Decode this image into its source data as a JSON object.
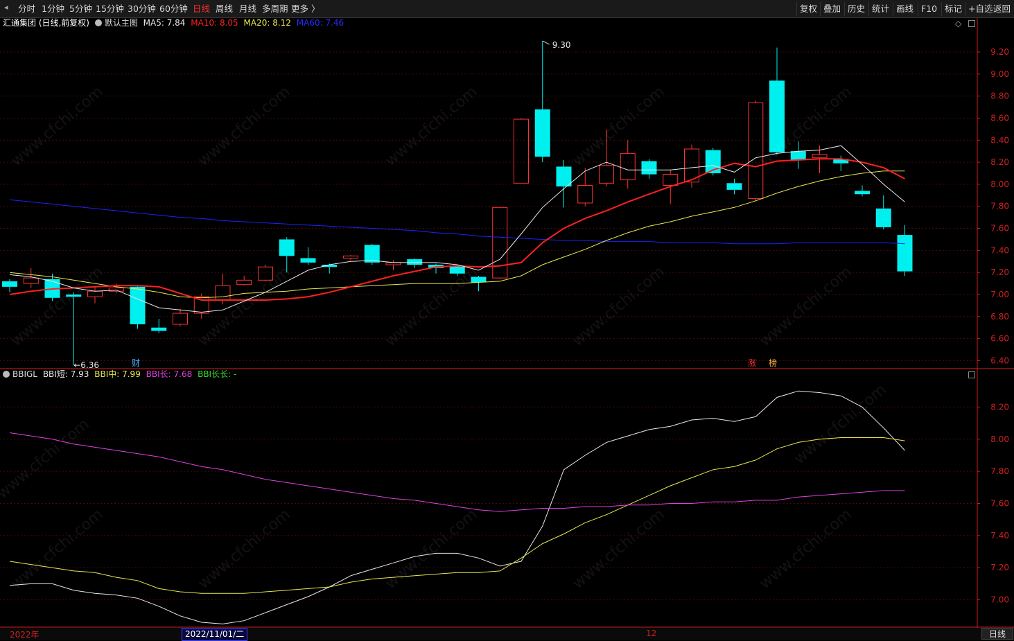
{
  "toolbar": {
    "periods": [
      "分时",
      "1分钟",
      "5分钟",
      "15分钟",
      "30分钟",
      "60分钟",
      "日线",
      "周线",
      "月线",
      "多周期",
      "更多 〉"
    ],
    "active_period": "日线",
    "right_buttons": [
      "复权",
      "叠加",
      "历史",
      "统计",
      "画线",
      "F10",
      "标记",
      "+自选",
      "返回"
    ]
  },
  "main_header": {
    "stock": "汇通集团 (日线,前复权)",
    "template": "默认主图",
    "ma5": "MA5: 7.84",
    "ma10": "MA10: 8.05",
    "ma20": "MA20: 8.12",
    "ma60": "MA60: 7.46"
  },
  "indicator_header": {
    "name": "BBIGL",
    "bbi_short": "BBI短: 7.93",
    "bbi_mid": "BBI中: 7.99",
    "bbi_long": "BBI长: 7.68",
    "bbi_longlong": "BBI长长: -"
  },
  "markers": {
    "high": "9.30",
    "low": "←6.36",
    "cai": "财",
    "zhang": "涨",
    "bang": "榜"
  },
  "x_axis": {
    "labels": [
      "2022年",
      "12"
    ],
    "cursor_date": "2022/11/01/二",
    "period_button": "日线"
  },
  "watermark": "www.cfchi.com",
  "colors": {
    "up": "#ff3232",
    "down": "#00f0f0",
    "ma5": "#e8e8e8",
    "ma10": "#ff2020",
    "ma20": "#e8e850",
    "ma60": "#2020ff",
    "bbi_short": "#e8e8e8",
    "bbi_mid": "#e8e850",
    "bbi_long": "#e040e0",
    "bbi_longlong": "#30e030",
    "axis": "#d02020"
  },
  "chart_data": [
    {
      "type": "candlestick",
      "y_ticks": [
        "9.20",
        "9.00",
        "8.80",
        "8.60",
        "8.40",
        "8.20",
        "8.00",
        "7.80",
        "7.60",
        "7.40",
        "7.20",
        "7.00",
        "6.80",
        "6.60",
        "6.40"
      ],
      "ylim": [
        6.34,
        9.42
      ],
      "candles": [
        {
          "o": 7.12,
          "c": 7.07,
          "h": 7.14,
          "l": 7.02
        },
        {
          "o": 7.1,
          "c": 7.15,
          "h": 7.24,
          "l": 7.06
        },
        {
          "o": 7.14,
          "c": 6.97,
          "h": 7.19,
          "l": 6.94
        },
        {
          "o": 7.0,
          "c": 6.98,
          "h": 7.02,
          "l": 6.36
        },
        {
          "o": 6.98,
          "c": 7.03,
          "h": 7.07,
          "l": 6.92
        },
        {
          "o": 7.03,
          "c": 7.06,
          "h": 7.1,
          "l": 7.01
        },
        {
          "o": 7.07,
          "c": 6.73,
          "h": 7.08,
          "l": 6.69
        },
        {
          "o": 6.7,
          "c": 6.67,
          "h": 6.78,
          "l": 6.65
        },
        {
          "o": 6.73,
          "c": 6.83,
          "h": 6.87,
          "l": 6.71
        },
        {
          "o": 6.83,
          "c": 6.98,
          "h": 7.01,
          "l": 6.78
        },
        {
          "o": 6.95,
          "c": 7.08,
          "h": 7.19,
          "l": 6.91
        },
        {
          "o": 7.09,
          "c": 7.13,
          "h": 7.17,
          "l": 7.08
        },
        {
          "o": 7.13,
          "c": 7.25,
          "h": 7.27,
          "l": 7.12
        },
        {
          "o": 7.5,
          "c": 7.35,
          "h": 7.52,
          "l": 7.2
        },
        {
          "o": 7.33,
          "c": 7.29,
          "h": 7.43,
          "l": 7.27
        },
        {
          "o": 7.27,
          "c": 7.25,
          "h": 7.28,
          "l": 7.19
        },
        {
          "o": 7.33,
          "c": 7.35,
          "h": 7.36,
          "l": 7.31
        },
        {
          "o": 7.45,
          "c": 7.29,
          "h": 7.46,
          "l": 7.27
        },
        {
          "o": 7.27,
          "c": 7.29,
          "h": 7.31,
          "l": 7.22
        },
        {
          "o": 7.32,
          "c": 7.27,
          "h": 7.33,
          "l": 7.24
        },
        {
          "o": 7.27,
          "c": 7.24,
          "h": 7.28,
          "l": 7.19
        },
        {
          "o": 7.26,
          "c": 7.19,
          "h": 7.27,
          "l": 7.17
        },
        {
          "o": 7.16,
          "c": 7.11,
          "h": 7.17,
          "l": 7.03
        },
        {
          "o": 7.15,
          "c": 7.79,
          "h": 7.79,
          "l": 7.14
        },
        {
          "o": 8.01,
          "c": 8.59,
          "h": 8.6,
          "l": 8.01
        },
        {
          "o": 8.68,
          "c": 8.25,
          "h": 9.3,
          "l": 8.2
        },
        {
          "o": 8.16,
          "c": 7.98,
          "h": 8.22,
          "l": 7.79
        },
        {
          "o": 7.83,
          "c": 7.99,
          "h": 8.15,
          "l": 7.8
        },
        {
          "o": 8.01,
          "c": 8.17,
          "h": 8.5,
          "l": 7.98
        },
        {
          "o": 8.04,
          "c": 8.28,
          "h": 8.4,
          "l": 7.96
        },
        {
          "o": 8.21,
          "c": 8.09,
          "h": 8.23,
          "l": 8.05
        },
        {
          "o": 7.99,
          "c": 8.09,
          "h": 8.13,
          "l": 7.82
        },
        {
          "o": 8.02,
          "c": 8.32,
          "h": 8.36,
          "l": 7.97
        },
        {
          "o": 8.31,
          "c": 8.1,
          "h": 8.33,
          "l": 8.08
        },
        {
          "o": 8.01,
          "c": 7.95,
          "h": 8.05,
          "l": 7.91
        },
        {
          "o": 7.87,
          "c": 8.74,
          "h": 8.76,
          "l": 7.85
        },
        {
          "o": 8.94,
          "c": 8.29,
          "h": 9.24,
          "l": 8.27
        },
        {
          "o": 8.3,
          "c": 8.22,
          "h": 8.39,
          "l": 8.14
        },
        {
          "o": 8.24,
          "c": 8.27,
          "h": 8.35,
          "l": 8.1
        },
        {
          "o": 8.23,
          "c": 8.19,
          "h": 8.26,
          "l": 8.12
        },
        {
          "o": 7.94,
          "c": 7.91,
          "h": 7.99,
          "l": 7.89
        },
        {
          "o": 7.78,
          "c": 7.61,
          "h": 7.9,
          "l": 7.59
        },
        {
          "o": 7.54,
          "c": 7.21,
          "h": 7.63,
          "l": 7.17
        }
      ],
      "ma5": [
        7.18,
        7.16,
        7.12,
        7.06,
        7.03,
        7.04,
        6.96,
        6.88,
        6.86,
        6.84,
        6.86,
        6.94,
        7.02,
        7.12,
        7.22,
        7.27,
        7.3,
        7.31,
        7.29,
        7.29,
        7.29,
        7.27,
        7.22,
        7.32,
        7.55,
        7.79,
        7.96,
        8.12,
        8.2,
        8.13,
        8.13,
        8.13,
        8.15,
        8.17,
        8.11,
        8.24,
        8.28,
        8.3,
        8.31,
        8.35,
        8.18,
        8.0,
        7.84
      ],
      "ma10": [
        7.0,
        7.03,
        7.05,
        7.06,
        7.07,
        7.08,
        7.08,
        7.07,
        7.01,
        6.95,
        6.95,
        6.95,
        6.95,
        6.96,
        6.98,
        7.02,
        7.07,
        7.12,
        7.17,
        7.21,
        7.25,
        7.26,
        7.25,
        7.26,
        7.29,
        7.47,
        7.6,
        7.69,
        7.76,
        7.84,
        7.91,
        7.98,
        8.04,
        8.13,
        8.19,
        8.16,
        8.21,
        8.22,
        8.23,
        8.23,
        8.2,
        8.15,
        8.05
      ],
      "ma20": [
        7.2,
        7.18,
        7.16,
        7.13,
        7.1,
        7.07,
        7.05,
        7.02,
        6.98,
        6.97,
        6.98,
        7.01,
        7.02,
        7.03,
        7.05,
        7.06,
        7.07,
        7.08,
        7.09,
        7.1,
        7.1,
        7.1,
        7.11,
        7.12,
        7.17,
        7.27,
        7.34,
        7.41,
        7.49,
        7.56,
        7.62,
        7.66,
        7.71,
        7.75,
        7.79,
        7.85,
        7.92,
        7.98,
        8.03,
        8.07,
        8.1,
        8.12,
        8.12
      ],
      "ma60": [
        7.86,
        7.84,
        7.82,
        7.8,
        7.78,
        7.76,
        7.74,
        7.72,
        7.7,
        7.69,
        7.67,
        7.66,
        7.65,
        7.64,
        7.63,
        7.62,
        7.61,
        7.6,
        7.59,
        7.58,
        7.56,
        7.55,
        7.53,
        7.52,
        7.51,
        7.5,
        7.49,
        7.49,
        7.48,
        7.48,
        7.48,
        7.47,
        7.47,
        7.47,
        7.46,
        7.46,
        7.46,
        7.47,
        7.47,
        7.47,
        7.47,
        7.47,
        7.46
      ]
    },
    {
      "type": "line",
      "name": "BBIGL",
      "y_ticks": [
        "8.20",
        "8.00",
        "7.80",
        "7.60",
        "7.40",
        "7.20",
        "7.00"
      ],
      "ylim": [
        6.83,
        8.37
      ],
      "series": [
        {
          "name": "BBI短",
          "values": [
            7.09,
            7.1,
            7.1,
            7.06,
            7.04,
            7.03,
            7.01,
            6.96,
            6.9,
            6.86,
            6.85,
            6.87,
            6.92,
            6.97,
            7.02,
            7.08,
            7.15,
            7.19,
            7.23,
            7.27,
            7.29,
            7.29,
            7.26,
            7.21,
            7.24,
            7.46,
            7.81,
            7.9,
            7.98,
            8.02,
            8.06,
            8.08,
            8.12,
            8.13,
            8.11,
            8.14,
            8.26,
            8.3,
            8.29,
            8.27,
            8.2,
            8.07,
            7.93
          ]
        },
        {
          "name": "BBI中",
          "values": [
            7.24,
            7.22,
            7.2,
            7.18,
            7.17,
            7.14,
            7.12,
            7.07,
            7.05,
            7.04,
            7.04,
            7.04,
            7.05,
            7.06,
            7.07,
            7.08,
            7.11,
            7.13,
            7.14,
            7.15,
            7.16,
            7.17,
            7.17,
            7.18,
            7.26,
            7.35,
            7.41,
            7.48,
            7.53,
            7.59,
            7.65,
            7.71,
            7.76,
            7.81,
            7.83,
            7.87,
            7.94,
            7.98,
            8.0,
            8.01,
            8.01,
            8.01,
            7.99
          ]
        },
        {
          "name": "BBI长",
          "values": [
            8.04,
            8.02,
            8.0,
            7.97,
            7.95,
            7.93,
            7.91,
            7.89,
            7.86,
            7.83,
            7.81,
            7.78,
            7.75,
            7.73,
            7.71,
            7.69,
            7.67,
            7.65,
            7.63,
            7.62,
            7.6,
            7.58,
            7.56,
            7.55,
            7.56,
            7.57,
            7.57,
            7.58,
            7.58,
            7.59,
            7.59,
            7.6,
            7.6,
            7.61,
            7.61,
            7.62,
            7.62,
            7.64,
            7.65,
            7.66,
            7.67,
            7.68,
            7.68
          ]
        }
      ]
    }
  ]
}
